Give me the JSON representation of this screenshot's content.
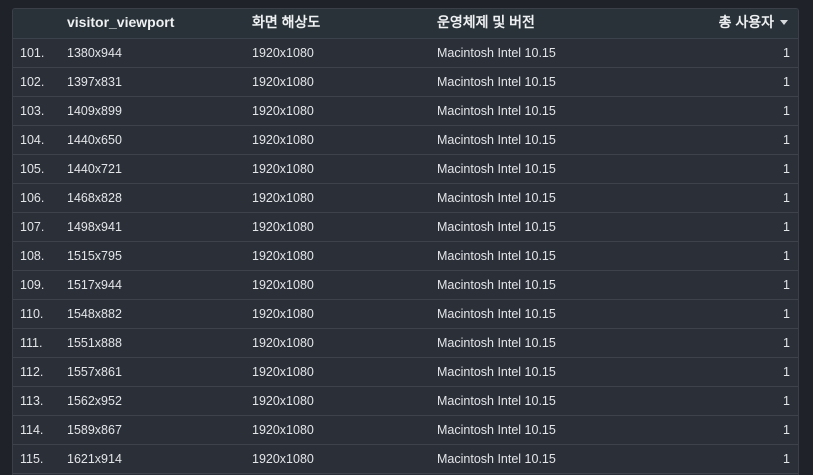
{
  "table": {
    "headers": {
      "viewport": "visitor_viewport",
      "resolution": "화면 해상도",
      "os": "운영체제 및 버전",
      "users": "총 사용자"
    },
    "rows": [
      {
        "idx": "101.",
        "viewport": "1380x944",
        "resolution": "1920x1080",
        "os": "Macintosh Intel 10.15",
        "users": "1"
      },
      {
        "idx": "102.",
        "viewport": "1397x831",
        "resolution": "1920x1080",
        "os": "Macintosh Intel 10.15",
        "users": "1"
      },
      {
        "idx": "103.",
        "viewport": "1409x899",
        "resolution": "1920x1080",
        "os": "Macintosh Intel 10.15",
        "users": "1"
      },
      {
        "idx": "104.",
        "viewport": "1440x650",
        "resolution": "1920x1080",
        "os": "Macintosh Intel 10.15",
        "users": "1"
      },
      {
        "idx": "105.",
        "viewport": "1440x721",
        "resolution": "1920x1080",
        "os": "Macintosh Intel 10.15",
        "users": "1"
      },
      {
        "idx": "106.",
        "viewport": "1468x828",
        "resolution": "1920x1080",
        "os": "Macintosh Intel 10.15",
        "users": "1"
      },
      {
        "idx": "107.",
        "viewport": "1498x941",
        "resolution": "1920x1080",
        "os": "Macintosh Intel 10.15",
        "users": "1"
      },
      {
        "idx": "108.",
        "viewport": "1515x795",
        "resolution": "1920x1080",
        "os": "Macintosh Intel 10.15",
        "users": "1"
      },
      {
        "idx": "109.",
        "viewport": "1517x944",
        "resolution": "1920x1080",
        "os": "Macintosh Intel 10.15",
        "users": "1"
      },
      {
        "idx": "110.",
        "viewport": "1548x882",
        "resolution": "1920x1080",
        "os": "Macintosh Intel 10.15",
        "users": "1"
      },
      {
        "idx": "111.",
        "viewport": "1551x888",
        "resolution": "1920x1080",
        "os": "Macintosh Intel 10.15",
        "users": "1"
      },
      {
        "idx": "112.",
        "viewport": "1557x861",
        "resolution": "1920x1080",
        "os": "Macintosh Intel 10.15",
        "users": "1"
      },
      {
        "idx": "113.",
        "viewport": "1562x952",
        "resolution": "1920x1080",
        "os": "Macintosh Intel 10.15",
        "users": "1"
      },
      {
        "idx": "114.",
        "viewport": "1589x867",
        "resolution": "1920x1080",
        "os": "Macintosh Intel 10.15",
        "users": "1"
      },
      {
        "idx": "115.",
        "viewport": "1621x914",
        "resolution": "1920x1080",
        "os": "Macintosh Intel 10.15",
        "users": "1"
      }
    ],
    "sort": {
      "column": "users",
      "direction": "descending",
      "icon": "sort-desc-icon"
    }
  }
}
